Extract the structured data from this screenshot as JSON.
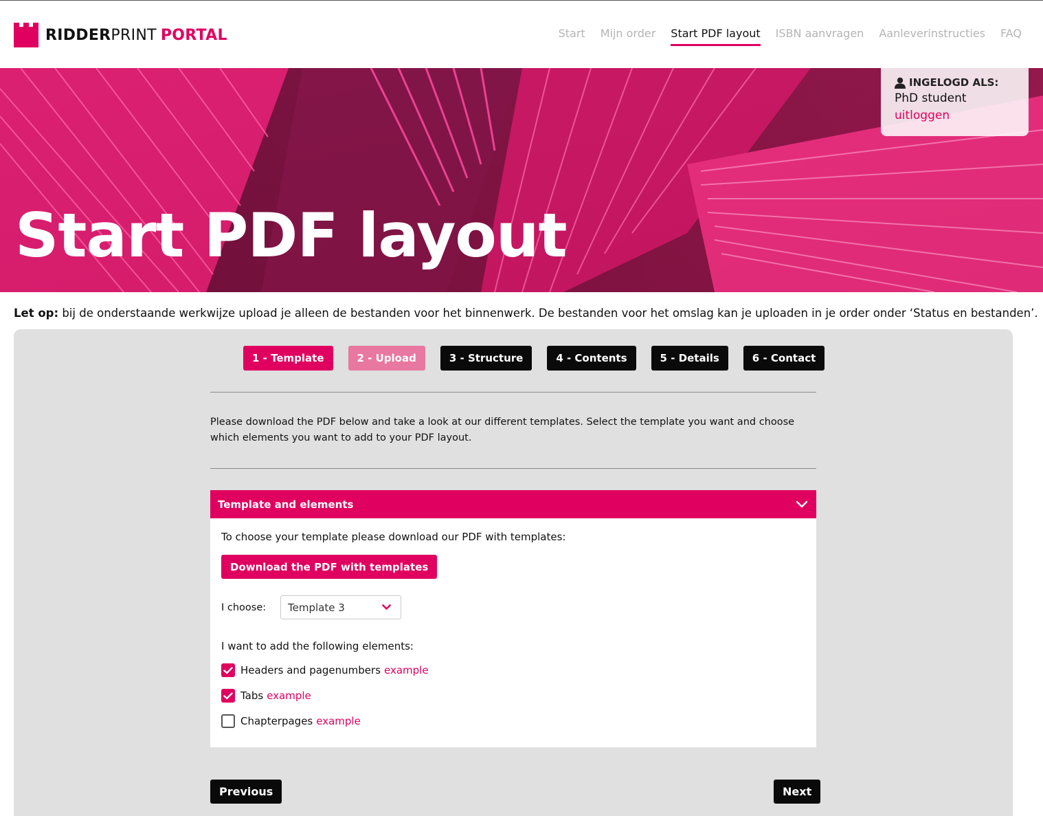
{
  "header": {
    "logo_bold": "RIDDER",
    "logo_regular": "PRINT",
    "logo_accent": "PORTAL",
    "nav": [
      {
        "label": "Start",
        "active": false
      },
      {
        "label": "Mijn order",
        "active": false
      },
      {
        "label": "Start PDF layout",
        "active": true
      },
      {
        "label": "ISBN aanvragen",
        "active": false
      },
      {
        "label": "Aanleverinstructies",
        "active": false
      },
      {
        "label": "FAQ",
        "active": false
      }
    ]
  },
  "hero": {
    "title": "Start PDF layout"
  },
  "login": {
    "label": "INGELOGD ALS:",
    "user": "PhD student",
    "logout": "uitloggen",
    "icon": "user-icon"
  },
  "notice": {
    "bold": "Let op:",
    "text": " bij de onderstaande werkwijze upload je alleen de bestanden voor het binnenwerk. De bestanden voor het omslag kan je uploaden in je order onder ‘Status en bestanden’."
  },
  "steps": [
    {
      "label": "1 - Template",
      "state": "current"
    },
    {
      "label": "2 - Upload",
      "state": "next"
    },
    {
      "label": "3 - Structure",
      "state": "pending"
    },
    {
      "label": "4 - Contents",
      "state": "pending"
    },
    {
      "label": "5 - Details",
      "state": "pending"
    },
    {
      "label": "6 - Contact",
      "state": "pending"
    }
  ],
  "intro": "Please download the PDF below and take a look at our different templates. Select the template you want and choose which elements you want to add to your PDF layout.",
  "accordion": {
    "title": "Template and elements",
    "icon": "chevron-down-icon",
    "download_text": "To choose your template please download our PDF with templates:",
    "download_button": "Download the PDF with templates",
    "choose_label": "I choose:",
    "select_value": "Template 3",
    "elements_title": "I want to add the following elements:",
    "elements": [
      {
        "label": "Headers and pagenumbers",
        "link": "example",
        "checked": true
      },
      {
        "label": "Tabs",
        "link": "example",
        "checked": true
      },
      {
        "label": "Chapterpages",
        "link": "example",
        "checked": false
      }
    ]
  },
  "buttons": {
    "previous": "Previous",
    "next": "Next"
  },
  "colors": {
    "accent": "#e0005f",
    "accent_light": "#e8789f",
    "dark": "#0a0a0a",
    "panel": "#dfe0df"
  }
}
